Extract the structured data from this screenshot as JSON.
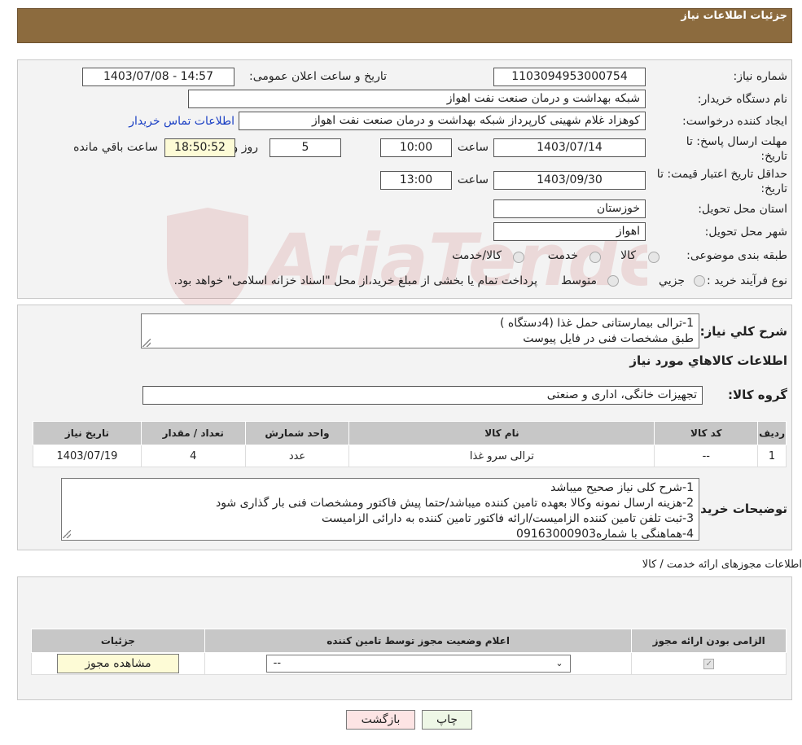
{
  "header": {
    "title": "جزئیات اطلاعات نیاز"
  },
  "details": {
    "need_number_label": "شماره نیاز:",
    "need_number": "1103094953000754",
    "announce_label": "تاریخ و ساعت اعلان عمومی:",
    "announce_value": "1403/07/08 - 14:57",
    "buyer_org_label": "نام دستگاه خریدار:",
    "buyer_org": "شبکه بهداشت و درمان صنعت نفت اهواز",
    "creator_label": "ایجاد کننده درخواست:",
    "creator": "کوهزاد غلام شهینی کارپرداز شبکه بهداشت و درمان صنعت نفت اهواز",
    "contact_link": "اطلاعات تماس خریدار",
    "deadline_label_1": "مهلت ارسال پاسخ: تا",
    "deadline_label_2": "تاریخ:",
    "deadline_date": "1403/07/14",
    "time_label": "ساعت",
    "deadline_time": "10:00",
    "days_value": "5",
    "days_label": "روز و",
    "remaining_time": "18:50:52",
    "remaining_label": "ساعت باقي مانده",
    "validity_label_1": "حداقل تاریخ اعتبار قیمت: تا",
    "validity_label_2": "تاریخ:",
    "validity_date": "1403/09/30",
    "validity_time_label": "ساعت",
    "validity_time": "13:00",
    "province_label": "استان محل تحویل:",
    "province": "خوزستان",
    "city_label": "شهر محل تحویل:",
    "city": "اهواز",
    "category_label": "طبقه بندی موضوعی:",
    "category_options": [
      "کالا",
      "خدمت",
      "کالا/خدمت"
    ],
    "process_label": "نوع فرآیند خرید :",
    "process_options": [
      "جزیي",
      "متوسط"
    ],
    "process_note": "پرداخت تمام یا بخشی از مبلغ خرید،از محل \"اسناد خزانه اسلامی\" خواهد بود."
  },
  "summary": {
    "label": "شرح کلي نیاز:",
    "lines": [
      "1-ترالی بیمارستانی حمل غذا (4دستگاه )",
      "طبق مشخصات فنی در فایل پیوست"
    ],
    "goods_info_title": "اطلاعات کالاهاي مورد نیاز",
    "goods_group_label": "گروه کالا:",
    "goods_group": "تجهیزات خانگی، اداری و صنعتی",
    "table": {
      "headers": [
        "ردیف",
        "کد کالا",
        "نام کالا",
        "واحد شمارش",
        "تعداد / مقدار",
        "تاریخ نیاز"
      ],
      "rows": [
        [
          "1",
          "--",
          "ترالی سرو غذا",
          "عدد",
          "4",
          "1403/07/19"
        ]
      ]
    },
    "buyer_notes_label": "توضیحات خریدار:",
    "buyer_notes": [
      "1-شرح کلی نیاز صحیح میباشد",
      "2-هزینه ارسال نمونه وکالا بعهده تامین کننده میباشد/حتما پیش فاکتور ومشخصات فنی بار گذاری شود",
      "3-ثبت تلفن تامین کننده الزامیست/ارائه فاکتور تامین کننده به دارائی الزامیست",
      "4-هماهنگی با شماره09163000903"
    ]
  },
  "permits": {
    "title": "اطلاعات مجوزهای ارائه خدمت / کالا",
    "headers": [
      "الزامی بودن ارائه مجوز",
      "اعلام وضعیت مجوز توسط تامین کننده",
      "جزئیات"
    ],
    "select_value": "--",
    "view_button": "مشاهده مجوز"
  },
  "buttons": {
    "print": "چاپ",
    "back": "بازگشت"
  },
  "colors": {
    "header": "#8c6b3e",
    "link": "#1a3fc4",
    "back_button": "#fde4e4",
    "print_button": "#eef7e6"
  }
}
